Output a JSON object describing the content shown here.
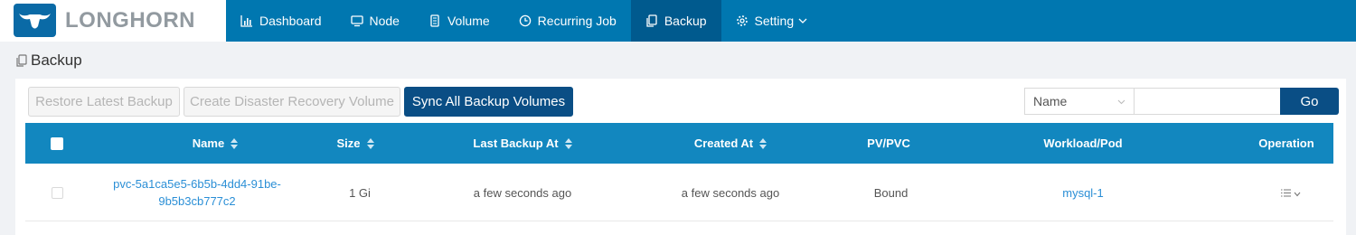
{
  "brand": {
    "name": "LONGHORN",
    "logo_color": "#0a6aa6",
    "header_color": "#0077b0"
  },
  "nav": [
    {
      "label": "Dashboard",
      "icon": "bar-chart-icon"
    },
    {
      "label": "Node",
      "icon": "monitor-icon"
    },
    {
      "label": "Volume",
      "icon": "database-icon"
    },
    {
      "label": "Recurring Job",
      "icon": "clock-icon"
    },
    {
      "label": "Backup",
      "icon": "copy-icon",
      "active": true
    },
    {
      "label": "Setting",
      "icon": "gear-icon",
      "has_dropdown": true
    }
  ],
  "page": {
    "title": "Backup",
    "title_icon": "copy-icon"
  },
  "toolbar": {
    "restore_label": "Restore Latest Backup",
    "dr_label": "Create Disaster Recovery Volume",
    "sync_label": "Sync All Backup Volumes"
  },
  "search": {
    "field_selected": "Name",
    "value": "",
    "go_label": "Go"
  },
  "table": {
    "columns": {
      "name": "Name",
      "size": "Size",
      "last_backup": "Last Backup At",
      "created": "Created At",
      "pv_pvc": "PV/PVC",
      "workload": "Workload/Pod",
      "operation": "Operation"
    },
    "rows": [
      {
        "name_line1": "pvc-5a1ca5e5-6b5b-4dd4-91be-",
        "name_line2": "9b5b3cb777c2",
        "size": "1 Gi",
        "last_backup": "a few seconds ago",
        "created": "a few seconds ago",
        "pv_pvc": "Bound",
        "workload": "mysql-1"
      }
    ]
  }
}
